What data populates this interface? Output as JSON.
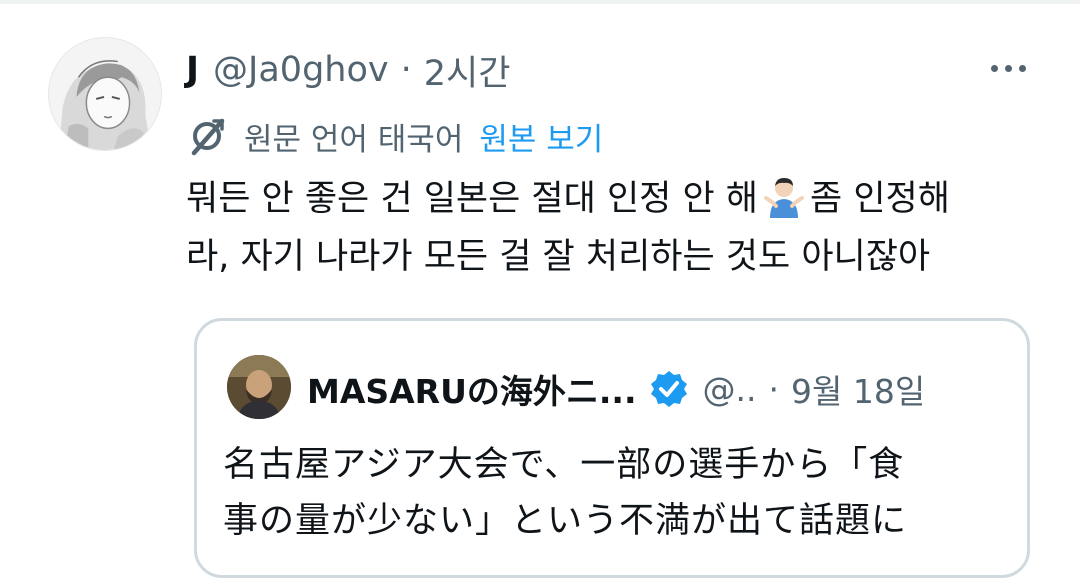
{
  "tweet": {
    "display_name": "J",
    "handle": "@Ja0ghov",
    "separator": "·",
    "time": "2시간",
    "more_icon": "more-horizontal-icon",
    "translate": {
      "icon": "translate-icon",
      "text": "원문 언어 태국어",
      "show_original": "원본 보기"
    },
    "text_lines": [
      {
        "before": "뭐든 안 좋은 건 일본은 절대 인정 안 해",
        "emoji": "person-shrugging-emoji",
        "after": "좀 인정해"
      },
      {
        "text": "라, 자기 나라가 모든 걸 잘 처리하는 것도 아니잖아"
      }
    ]
  },
  "quote": {
    "display_name": "MASARUの海外ニ...",
    "verified_icon": "verified-badge-icon",
    "handle": "@..",
    "separator": "·",
    "time": "9월 18일",
    "text_lines": [
      "名古屋アジア大会で、一部の選手から「食",
      "事の量が少ない」という不満が出て話題に"
    ]
  },
  "colors": {
    "text_primary": "#0f1419",
    "text_secondary": "#536471",
    "link": "#1d9bf0",
    "border": "#cfd9de",
    "verified": "#1d9bf0"
  }
}
